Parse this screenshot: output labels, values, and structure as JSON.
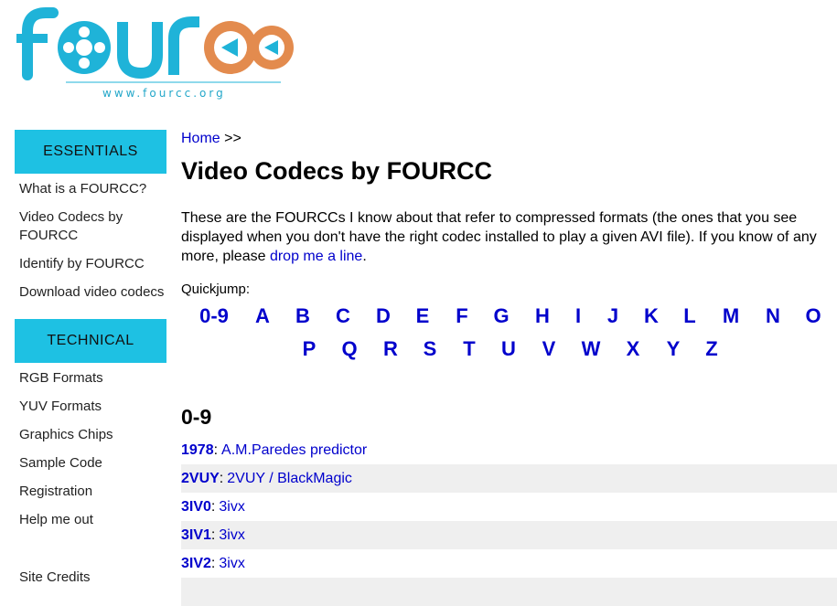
{
  "logo": {
    "text": "fourcc",
    "url": "www.fourcc.org",
    "colors": {
      "primary": "#1fb3d8",
      "accent": "#e38b4e"
    }
  },
  "sidebar": {
    "sections": [
      {
        "heading": "ESSENTIALS",
        "items": [
          "What is a FOURCC?",
          "Video Codecs by FOURCC",
          "Identify by FOURCC",
          "Download video codecs"
        ]
      },
      {
        "heading": "TECHNICAL",
        "items": [
          "RGB Formats",
          "YUV Formats",
          "Graphics Chips",
          "Sample Code",
          "Registration",
          "Help me out"
        ]
      }
    ],
    "footer_link": "Site Credits"
  },
  "breadcrumb": {
    "home": "Home",
    "separator": ">>"
  },
  "page_title": "Video Codecs by FOURCC",
  "intro": {
    "text": "These are the FOURCCs I know about that refer to compressed formats (the ones that you see displayed when you don't have the right codec installed to play a given AVI file). If you know of any more, please ",
    "link": "drop me a line",
    "end": "."
  },
  "quickjump": {
    "label": "Quickjump:",
    "row1": [
      "0-9",
      "A",
      "B",
      "C",
      "D",
      "E",
      "F",
      "G",
      "H",
      "I",
      "J",
      "K",
      "L",
      "M",
      "N",
      "O"
    ],
    "row2": [
      "P",
      "Q",
      "R",
      "S",
      "T",
      "U",
      "V",
      "W",
      "X",
      "Y",
      "Z"
    ]
  },
  "section": {
    "heading": "0-9",
    "entries": [
      {
        "code": "1978",
        "desc": "A.M.Paredes predictor"
      },
      {
        "code": "2VUY",
        "desc": "2VUY / BlackMagic"
      },
      {
        "code": "3IV0",
        "desc": "3ivx"
      },
      {
        "code": "3IV1",
        "desc": "3ivx"
      },
      {
        "code": "3IV2",
        "desc": "3ivx"
      }
    ]
  }
}
